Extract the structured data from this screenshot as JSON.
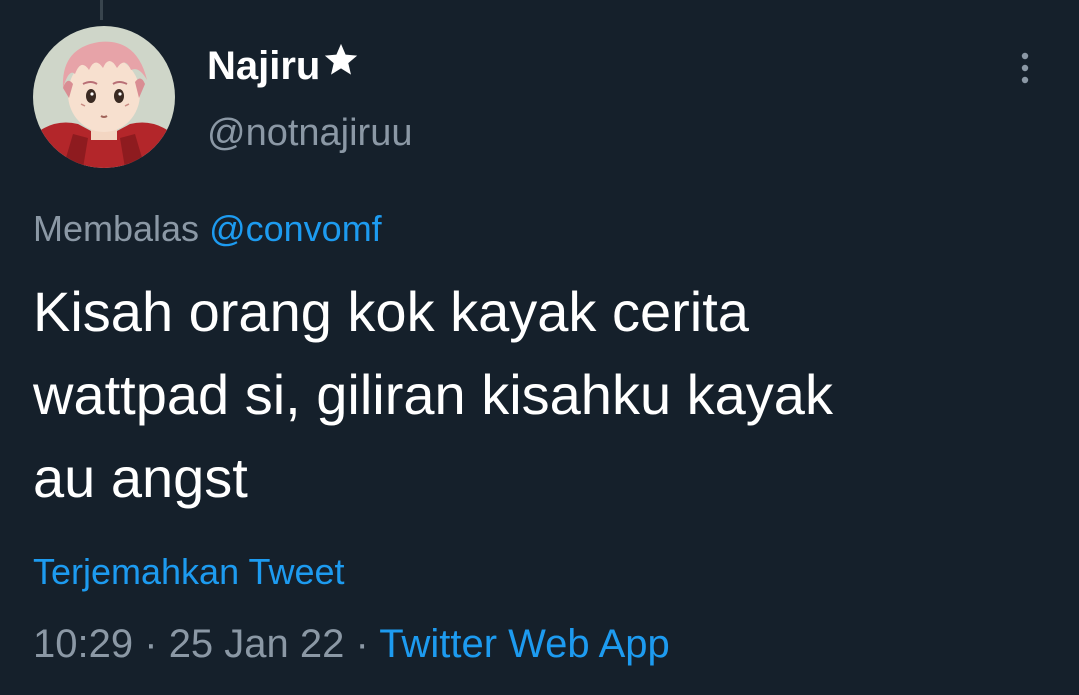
{
  "tweet": {
    "author": {
      "display_name": "Najiru",
      "badge_icon": "star-icon",
      "handle": "@notnajiruu",
      "avatar_icon": "anime-avatar"
    },
    "reply_context": {
      "prefix": "Membalas",
      "handle": "@convomf"
    },
    "text_lines": [
      "Kisah orang kok kayak cerita",
      "wattpad si, giliran kisahku kayak",
      "au angst"
    ],
    "translate_label": "Terjemahkan Tweet",
    "meta": {
      "time": "10:29",
      "separator": "·",
      "date": "25 Jan 22",
      "source": "Twitter Web App"
    },
    "more_icon": "more-vertical-icon"
  },
  "colors": {
    "background": "#15202b",
    "primary_text": "#ffffff",
    "secondary_text": "#8b98a5",
    "accent": "#1d9bf0"
  }
}
